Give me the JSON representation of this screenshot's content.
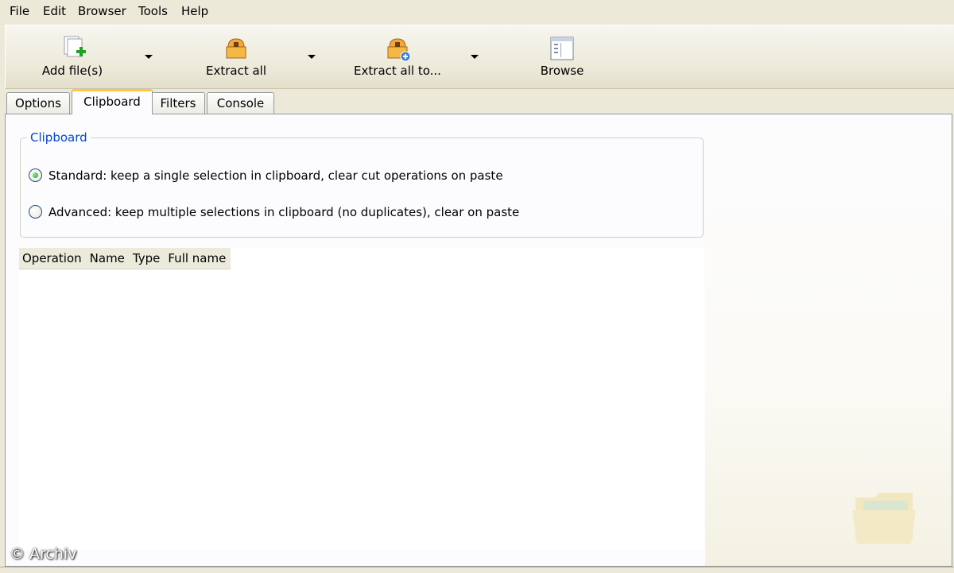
{
  "menu": [
    "File",
    "Edit",
    "Browser",
    "Tools",
    "Help"
  ],
  "toolbar": {
    "add_files": "Add file(s)",
    "extract_all": "Extract all",
    "extract_all_to": "Extract all to...",
    "browse": "Browse"
  },
  "tabs": [
    "Options",
    "Clipboard",
    "Filters",
    "Console"
  ],
  "active_tab": "Clipboard",
  "clipboard": {
    "group_title": "Clipboard",
    "standard_label": "Standard: keep a single selection in clipboard, clear cut operations on paste",
    "advanced_label": "Advanced: keep multiple selections in clipboard (no duplicates), clear on paste",
    "selected": "standard"
  },
  "list": {
    "columns": [
      "Operation",
      "Name",
      "Type",
      "Full name"
    ]
  },
  "watermark": "© Archiv",
  "icons": {
    "add_files": "add-file-icon",
    "extract_all": "extract-archive-icon",
    "extract_all_to": "extract-to-icon",
    "browse": "browse-window-icon",
    "corner": "folder-icon"
  },
  "colors": {
    "window_bg": "#ece9d8",
    "panel_bg": "#fcfcfe",
    "active_tab_accent": "#ffc83c",
    "group_title": "#0046d5"
  }
}
